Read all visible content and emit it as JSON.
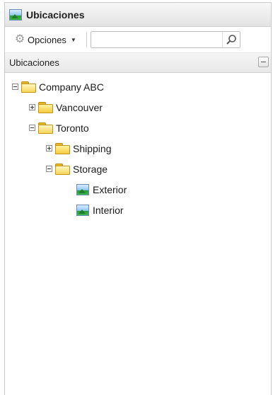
{
  "window": {
    "title": "Ubicaciones"
  },
  "toolbar": {
    "options_label": "Opciones",
    "search_value": "",
    "search_placeholder": ""
  },
  "section": {
    "header": "Ubicaciones"
  },
  "tree": {
    "root": "Company ABC",
    "vancouver": "Vancouver",
    "toronto": "Toronto",
    "shipping": "Shipping",
    "storage": "Storage",
    "exterior": "Exterior",
    "interior": "Interior"
  },
  "icons": {
    "title": "image-icon",
    "options": "gear-icon",
    "search": "magnifier-icon",
    "collapse": "minus-icon",
    "folder": "folder-icon",
    "camera": "image-icon"
  },
  "colors": {
    "folder": "#f3cc3e",
    "panel_border": "#c9c9c9"
  }
}
